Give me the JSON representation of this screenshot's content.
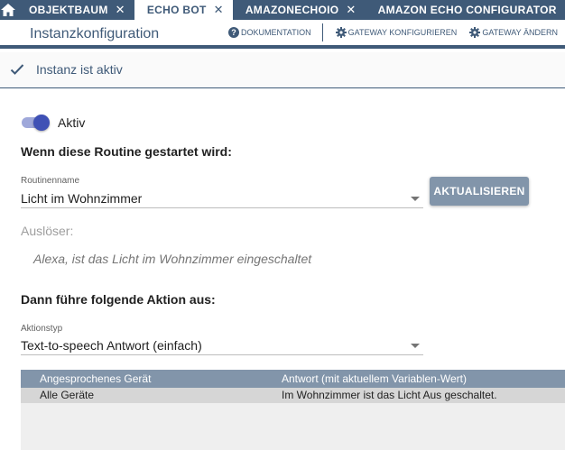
{
  "tabs": [
    {
      "label": "OBJEKTBAUM",
      "active": false
    },
    {
      "label": "ECHO BOT",
      "active": true
    },
    {
      "label": "AMAZONECHOIO",
      "active": false
    },
    {
      "label": "AMAZON ECHO CONFIGURATOR",
      "active": false
    }
  ],
  "header": {
    "title": "Instanzkonfiguration",
    "actions": {
      "documentation": "DOKUMENTATION",
      "configure_gateway": "GATEWAY KONFIGURIEREN",
      "change_gateway": "GATEWAY ÄNDERN"
    }
  },
  "status": {
    "text": "Instanz ist aktiv"
  },
  "toggle": {
    "label": "Aktiv",
    "checked": true
  },
  "routine_section": {
    "heading": "Wenn diese Routine gestartet wird:",
    "routine_label": "Routinenname",
    "routine_value": "Licht im Wohnzimmer",
    "refresh_button": "AKTUALISIEREN",
    "trigger_label": "Auslöser:",
    "trigger_text": "Alexa, ist das Licht im Wohnzimmer eingeschaltet"
  },
  "action_section": {
    "heading": "Dann führe folgende Aktion aus:",
    "action_type_label": "Aktionstyp",
    "action_type_value": "Text-to-speech Antwort (einfach)"
  },
  "table": {
    "columns": [
      "Angesprochenes Gerät",
      "Antwort (mit aktuellem Variablen-Wert)"
    ],
    "rows": [
      [
        "Alle Geräte",
        "Im Wohnzimmer ist das Licht Aus geschaltet."
      ]
    ]
  },
  "colors": {
    "primary": "#3f5a78",
    "toggle_on": "#3f51b5",
    "button": "#8295aa",
    "table_header": "#8295aa"
  }
}
